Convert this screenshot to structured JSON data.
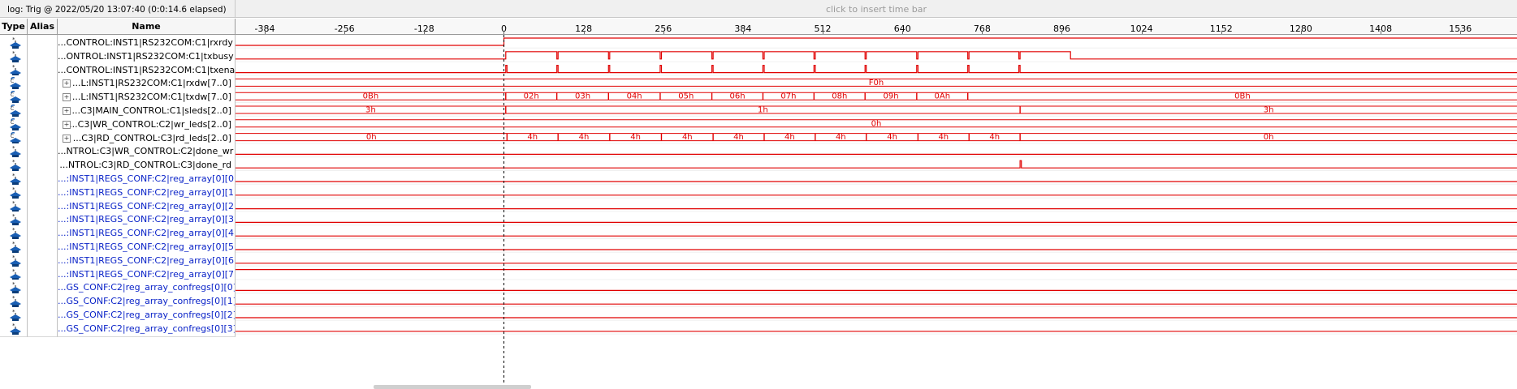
{
  "title": "log: Trig @ 2022/05/20 13:07:40 (0:0:14.6 elapsed)",
  "insert_hint": "click to insert time bar",
  "headers": {
    "type": "Type",
    "alias": "Alias",
    "name": "Name"
  },
  "ruler": {
    "ticks": [
      -384,
      -256,
      -128,
      0,
      128,
      256,
      384,
      512,
      640,
      768,
      896,
      1024,
      1152,
      1280,
      1408,
      1536
    ],
    "range": [
      -431,
      1627
    ],
    "trigger": 0
  },
  "colors": {
    "wave": "#e00000",
    "name_black": "#000000",
    "name_blue": "#0a23c8",
    "icon": "#1a5fb4"
  },
  "signals": [
    {
      "name": "...CONTROL:INST1|RS232COM:C1|rxrdy",
      "kind": "bit",
      "icon": "bit-icon",
      "color": "black",
      "edges": [
        [
          -431,
          0
        ],
        [
          0,
          1
        ]
      ]
    },
    {
      "name": "...ONTROL:INST1|RS232COM:C1|txbusy",
      "kind": "bit",
      "icon": "bit-icon",
      "color": "black",
      "edges": [
        [
          -431,
          0
        ],
        [
          3,
          1
        ],
        [
          85,
          0
        ],
        [
          87,
          1
        ],
        [
          168,
          0
        ],
        [
          170,
          1
        ],
        [
          251,
          0
        ],
        [
          253,
          1
        ],
        [
          334,
          0
        ],
        [
          336,
          1
        ],
        [
          416,
          0
        ],
        [
          418,
          1
        ],
        [
          498,
          0
        ],
        [
          500,
          1
        ],
        [
          580,
          0
        ],
        [
          582,
          1
        ],
        [
          663,
          0
        ],
        [
          665,
          1
        ],
        [
          745,
          0
        ],
        [
          747,
          1
        ],
        [
          827,
          0
        ],
        [
          829,
          1
        ],
        [
          910,
          0
        ]
      ]
    },
    {
      "name": "...CONTROL:INST1|RS232COM:C1|txena",
      "kind": "bit",
      "icon": "bit-icon",
      "color": "black",
      "edges": [
        [
          -431,
          0
        ],
        [
          3,
          1
        ],
        [
          5,
          0
        ],
        [
          85,
          1
        ],
        [
          87,
          0
        ],
        [
          168,
          1
        ],
        [
          170,
          0
        ],
        [
          251,
          1
        ],
        [
          253,
          0
        ],
        [
          334,
          1
        ],
        [
          336,
          0
        ],
        [
          416,
          1
        ],
        [
          418,
          0
        ],
        [
          498,
          1
        ],
        [
          500,
          0
        ],
        [
          580,
          1
        ],
        [
          582,
          0
        ],
        [
          663,
          1
        ],
        [
          665,
          0
        ],
        [
          745,
          1
        ],
        [
          747,
          0
        ],
        [
          827,
          1
        ],
        [
          829,
          0
        ]
      ]
    },
    {
      "name": "...L:INST1|RS232COM:C1|rxdw[7..0]",
      "kind": "bus",
      "icon": "bus-icon",
      "color": "black",
      "expander": "+",
      "segments": [
        [
          -431,
          1627,
          "F0h"
        ]
      ]
    },
    {
      "name": "...L:INST1|RS232COM:C1|txdw[7..0]",
      "kind": "bus",
      "icon": "bus-icon",
      "color": "black",
      "expander": "+",
      "segments": [
        [
          -431,
          3,
          "0Bh"
        ],
        [
          3,
          85,
          "02h"
        ],
        [
          85,
          168,
          "03h"
        ],
        [
          168,
          251,
          "04h"
        ],
        [
          251,
          334,
          "05h"
        ],
        [
          334,
          416,
          "06h"
        ],
        [
          416,
          498,
          "07h"
        ],
        [
          498,
          580,
          "08h"
        ],
        [
          580,
          663,
          "09h"
        ],
        [
          663,
          745,
          "0Ah"
        ],
        [
          745,
          1627,
          "0Bh"
        ]
      ]
    },
    {
      "name": "...C3|MAIN_CONTROL:C1|sleds[2..0]",
      "kind": "bus",
      "icon": "bus-icon",
      "color": "black",
      "expander": "+",
      "segments": [
        [
          -431,
          3,
          "3h"
        ],
        [
          3,
          829,
          "1h"
        ],
        [
          829,
          1627,
          "3h"
        ]
      ]
    },
    {
      "name": "...C3|WR_CONTROL:C2|wr_leds[2..0]",
      "kind": "bus",
      "icon": "bus-icon",
      "color": "black",
      "expander": "+",
      "segments": [
        [
          -431,
          1627,
          "0h"
        ]
      ]
    },
    {
      "name": "...C3|RD_CONTROL:C3|rd_leds[2..0]",
      "kind": "bus",
      "icon": "bus-icon",
      "color": "black",
      "expander": "+",
      "segments": [
        [
          -431,
          5,
          "0h"
        ],
        [
          5,
          87,
          "4h"
        ],
        [
          87,
          170,
          "4h"
        ],
        [
          170,
          253,
          "4h"
        ],
        [
          253,
          336,
          "4h"
        ],
        [
          336,
          418,
          "4h"
        ],
        [
          418,
          500,
          "4h"
        ],
        [
          500,
          582,
          "4h"
        ],
        [
          582,
          665,
          "4h"
        ],
        [
          665,
          747,
          "4h"
        ],
        [
          747,
          829,
          "4h"
        ],
        [
          829,
          1627,
          "0h"
        ]
      ]
    },
    {
      "name": "...NTROL:C3|WR_CONTROL:C2|done_wr",
      "kind": "bit",
      "icon": "bit-icon",
      "color": "black",
      "edges": [
        [
          -431,
          0
        ]
      ]
    },
    {
      "name": "...NTROL:C3|RD_CONTROL:C3|done_rd",
      "kind": "bit",
      "icon": "bit-icon",
      "color": "black",
      "edges": [
        [
          -431,
          0
        ],
        [
          829,
          1
        ],
        [
          831,
          0
        ]
      ]
    },
    {
      "name": "...:INST1|REGS_CONF:C2|reg_array[0][0]",
      "kind": "bit",
      "icon": "bit-icon",
      "color": "blue",
      "edges": [
        [
          -431,
          0
        ]
      ]
    },
    {
      "name": "...:INST1|REGS_CONF:C2|reg_array[0][1]",
      "kind": "bit",
      "icon": "bit-icon",
      "color": "blue",
      "edges": [
        [
          -431,
          0
        ]
      ]
    },
    {
      "name": "...:INST1|REGS_CONF:C2|reg_array[0][2]",
      "kind": "bit",
      "icon": "bit-icon",
      "color": "blue",
      "edges": [
        [
          -431,
          0
        ]
      ]
    },
    {
      "name": "...:INST1|REGS_CONF:C2|reg_array[0][3]",
      "kind": "bit",
      "icon": "bit-icon",
      "color": "blue",
      "edges": [
        [
          -431,
          0
        ]
      ]
    },
    {
      "name": "...:INST1|REGS_CONF:C2|reg_array[0][4]",
      "kind": "bit",
      "icon": "bit-icon",
      "color": "blue",
      "edges": [
        [
          -431,
          0
        ]
      ]
    },
    {
      "name": "...:INST1|REGS_CONF:C2|reg_array[0][5]",
      "kind": "bit",
      "icon": "bit-icon",
      "color": "blue",
      "edges": [
        [
          -431,
          0
        ]
      ]
    },
    {
      "name": "...:INST1|REGS_CONF:C2|reg_array[0][6]",
      "kind": "bit",
      "icon": "bit-icon",
      "color": "blue",
      "edges": [
        [
          -431,
          0
        ]
      ]
    },
    {
      "name": "...:INST1|REGS_CONF:C2|reg_array[0][7]",
      "kind": "bit",
      "icon": "bit-icon",
      "color": "blue",
      "edges": [
        [
          -431,
          1
        ]
      ]
    },
    {
      "name": "...GS_CONF:C2|reg_array_confregs[0][0]",
      "kind": "bit",
      "icon": "bit-icon",
      "color": "blue",
      "edges": [
        [
          -431,
          0
        ]
      ]
    },
    {
      "name": "...GS_CONF:C2|reg_array_confregs[0][1]",
      "kind": "bit",
      "icon": "bit-icon",
      "color": "blue",
      "edges": [
        [
          -431,
          0
        ]
      ]
    },
    {
      "name": "...GS_CONF:C2|reg_array_confregs[0][2]",
      "kind": "bit",
      "icon": "bit-icon",
      "color": "blue",
      "edges": [
        [
          -431,
          0
        ]
      ]
    },
    {
      "name": "...GS_CONF:C2|reg_array_confregs[0][3]",
      "kind": "bit",
      "icon": "bit-icon",
      "color": "blue",
      "edges": [
        [
          -431,
          0
        ]
      ]
    }
  ]
}
